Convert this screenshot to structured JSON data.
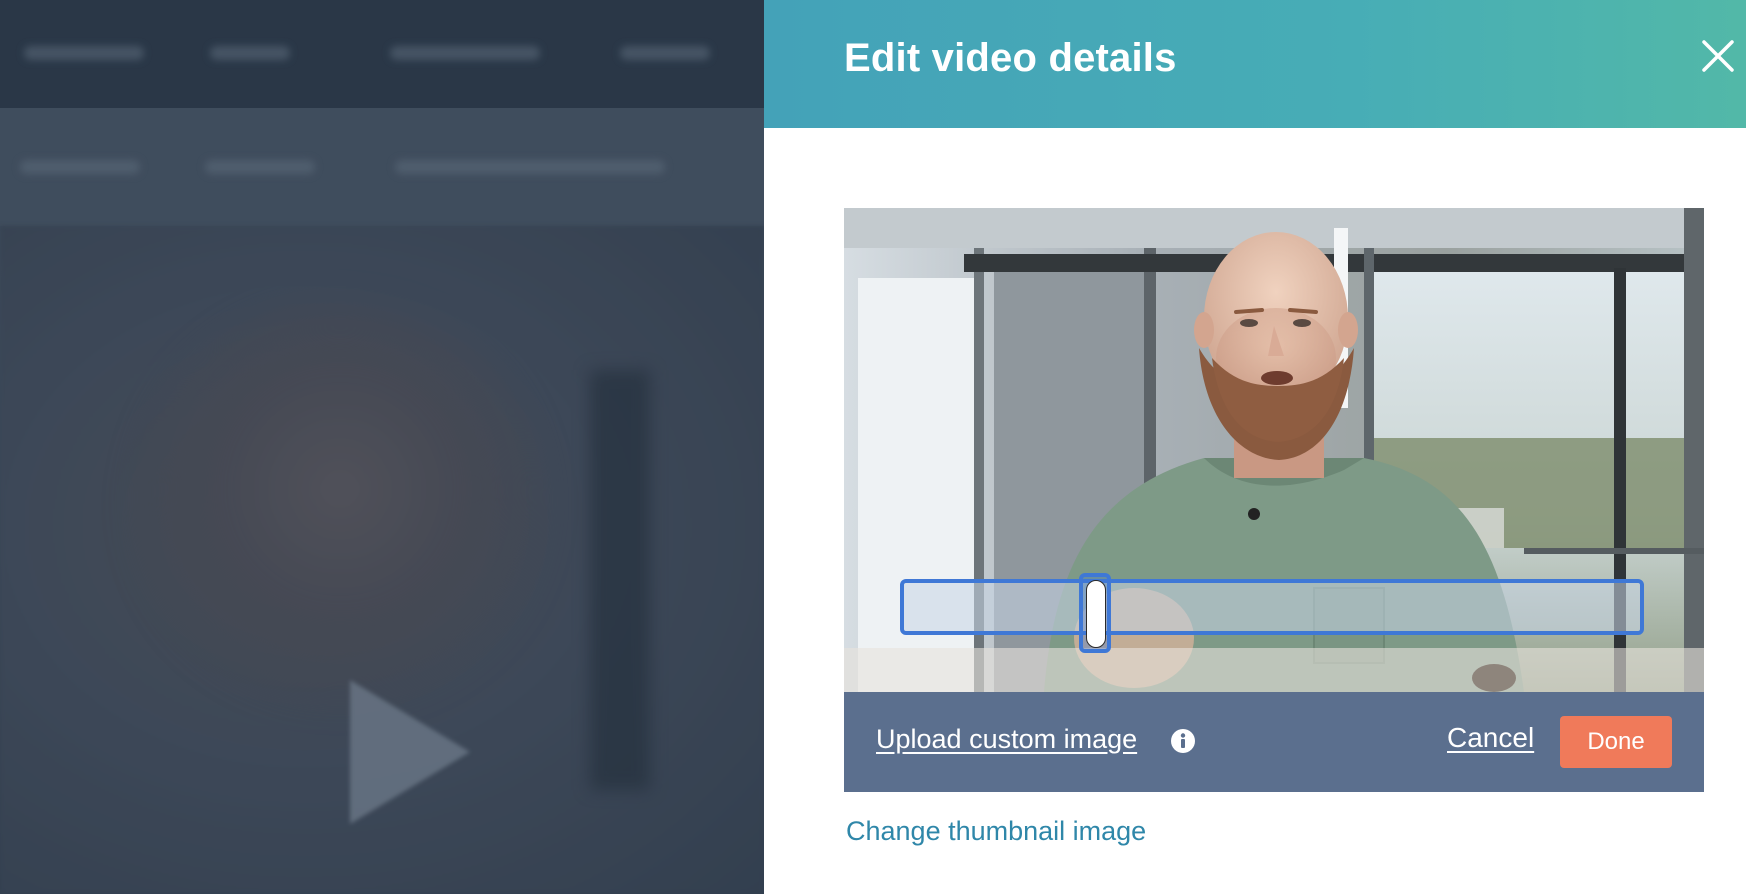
{
  "panel": {
    "title": "Edit video details",
    "close_icon": "close-icon"
  },
  "thumbnail_editor": {
    "scrubber_position": 0.26,
    "upload_label": "Upload custom image",
    "info_icon": "info-icon",
    "cancel_label": "Cancel",
    "done_label": "Done"
  },
  "change_thumbnail_label": "Change thumbnail image",
  "colors": {
    "header_start": "#44a2b8",
    "header_end": "#52b8a8",
    "toolbar": "#5b6f8e",
    "done_button": "#f07a5a",
    "link": "#2f87a9",
    "scrubber_focus": "#3f78d6"
  }
}
